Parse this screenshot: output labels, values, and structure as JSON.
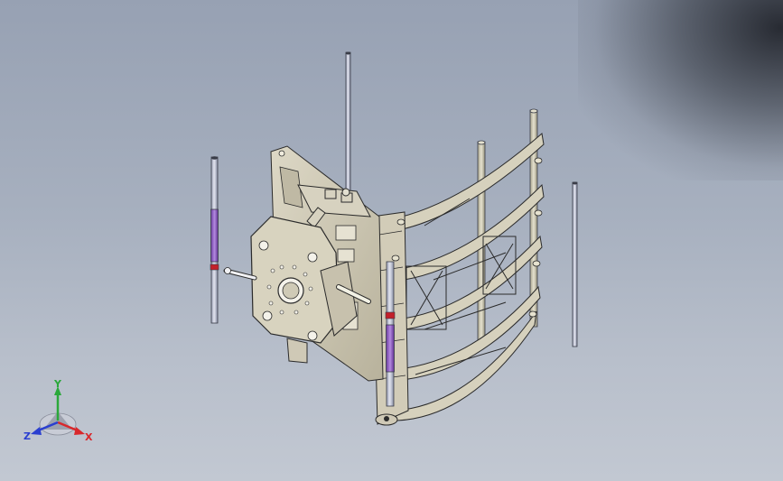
{
  "viewport": {
    "background_top": "#97a1b3",
    "background_bottom": "#c2c8d2"
  },
  "colors": {
    "frame_fill": "#cfc9b6",
    "frame_stroke": "#2b2b2b",
    "rod_fill": "#c9ccd8",
    "rod_purple": "#8a5bc0",
    "rod_tan": "#c8c2aa",
    "red_ring": "#c2202a",
    "axis_x": "#d8282c",
    "axis_y": "#2aa83a",
    "axis_z": "#2a3fd0"
  },
  "triad": {
    "x_label": "X",
    "y_label": "Y",
    "z_label": "Z"
  }
}
